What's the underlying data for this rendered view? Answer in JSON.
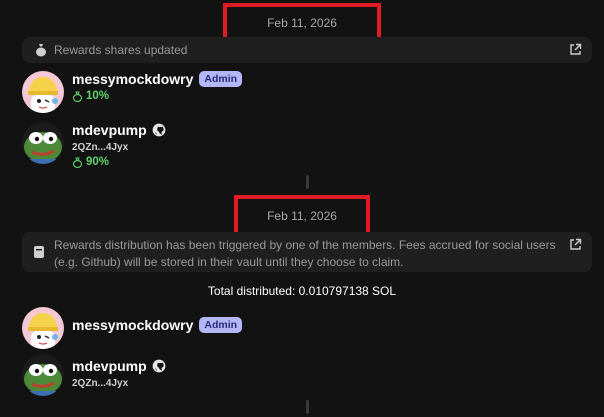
{
  "events": [
    {
      "date": "Feb 11, 2026",
      "message": "Rewards shares updated",
      "users": [
        {
          "name": "messymockdowry",
          "badge": "Admin",
          "share": "10%"
        },
        {
          "name": "mdevpump",
          "address": "2QZn...4Jyx",
          "share": "90%"
        }
      ]
    },
    {
      "date": "Feb 11, 2026",
      "message": "Rewards distribution has been triggered by one of the members. Fees accrued for social users (e.g. Github) will be stored in their vault until they choose to claim.",
      "total": "Total distributed: 0.010797138 SOL",
      "users": [
        {
          "name": "messymockdowry",
          "badge": "Admin"
        },
        {
          "name": "mdevpump",
          "address": "2QZn...4Jyx"
        }
      ]
    }
  ],
  "colors": {
    "accent_red": "#e01b24",
    "share_green": "#5fd36b",
    "badge_bg": "#b4b7f5"
  },
  "icons": [
    "money-bag-icon",
    "external-link-icon",
    "receipt-icon",
    "github-icon",
    "share-icon"
  ]
}
